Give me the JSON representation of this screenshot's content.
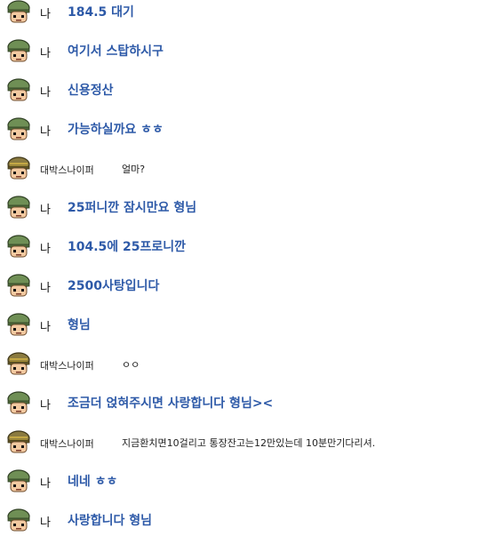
{
  "messages": [
    {
      "speaker": "나",
      "type": "me",
      "text": "184.5 대기"
    },
    {
      "speaker": "나",
      "type": "me",
      "text": "여기서 스탑하시구"
    },
    {
      "speaker": "나",
      "type": "me",
      "text": "신용정산"
    },
    {
      "speaker": "나",
      "type": "me",
      "text": "가능하실까요 ㅎㅎ"
    },
    {
      "speaker": "대박스나이퍼",
      "type": "other",
      "text": "얼마?"
    },
    {
      "speaker": "나",
      "type": "me",
      "text": "25퍼니깐 잠시만요 형님"
    },
    {
      "speaker": "나",
      "type": "me",
      "text": "104.5에 25프로니깐"
    },
    {
      "speaker": "나",
      "type": "me",
      "text": "2500사탕입니다"
    },
    {
      "speaker": "나",
      "type": "me",
      "text": "형님"
    },
    {
      "speaker": "대박스나이퍼",
      "type": "other",
      "text": "ㅇㅇ"
    },
    {
      "speaker": "나",
      "type": "me",
      "text": "조금더 얹혀주시면 사랑합니다 형님><"
    },
    {
      "speaker": "대박스나이퍼",
      "type": "other",
      "text": "지금환치면10걸리고 통장잔고는12만있는데 10분만기다리셔."
    },
    {
      "speaker": "나",
      "type": "me",
      "text": "네네 ㅎㅎ"
    },
    {
      "speaker": "나",
      "type": "me",
      "text": "사랑합니다 형님"
    }
  ]
}
